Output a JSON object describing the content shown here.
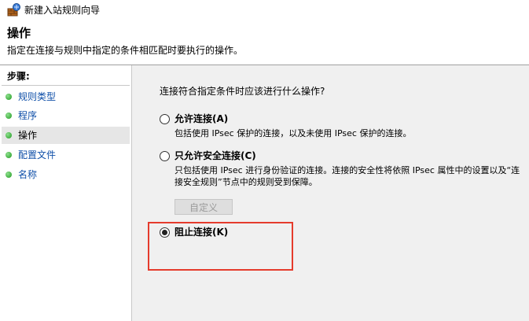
{
  "window": {
    "title": "新建入站规则向导"
  },
  "header": {
    "title": "操作",
    "description": "指定在连接与规则中指定的条件相匹配时要执行的操作。"
  },
  "sidebar": {
    "steps_label": "步骤:",
    "items": [
      {
        "label": "规则类型",
        "active": false
      },
      {
        "label": "程序",
        "active": false
      },
      {
        "label": "操作",
        "active": true
      },
      {
        "label": "配置文件",
        "active": false
      },
      {
        "label": "名称",
        "active": false
      }
    ]
  },
  "main": {
    "question": "连接符合指定条件时应该进行什么操作?",
    "options": [
      {
        "label": "允许连接(A)",
        "desc": "包括使用 IPsec 保护的连接，以及未使用 IPsec 保护的连接。",
        "checked": false
      },
      {
        "label": "只允许安全连接(C)",
        "desc": "只包括使用 IPsec 进行身份验证的连接。连接的安全性将依照 IPsec 属性中的设置以及“连接安全规则”节点中的规则受到保障。",
        "checked": false
      },
      {
        "label": "阻止连接(K)",
        "desc": "",
        "checked": true
      }
    ],
    "customize_label": "自定义"
  },
  "colors": {
    "link_blue": "#0f4fa8",
    "highlight_red": "#e53b2c",
    "content_bg": "#f0f0f0"
  }
}
